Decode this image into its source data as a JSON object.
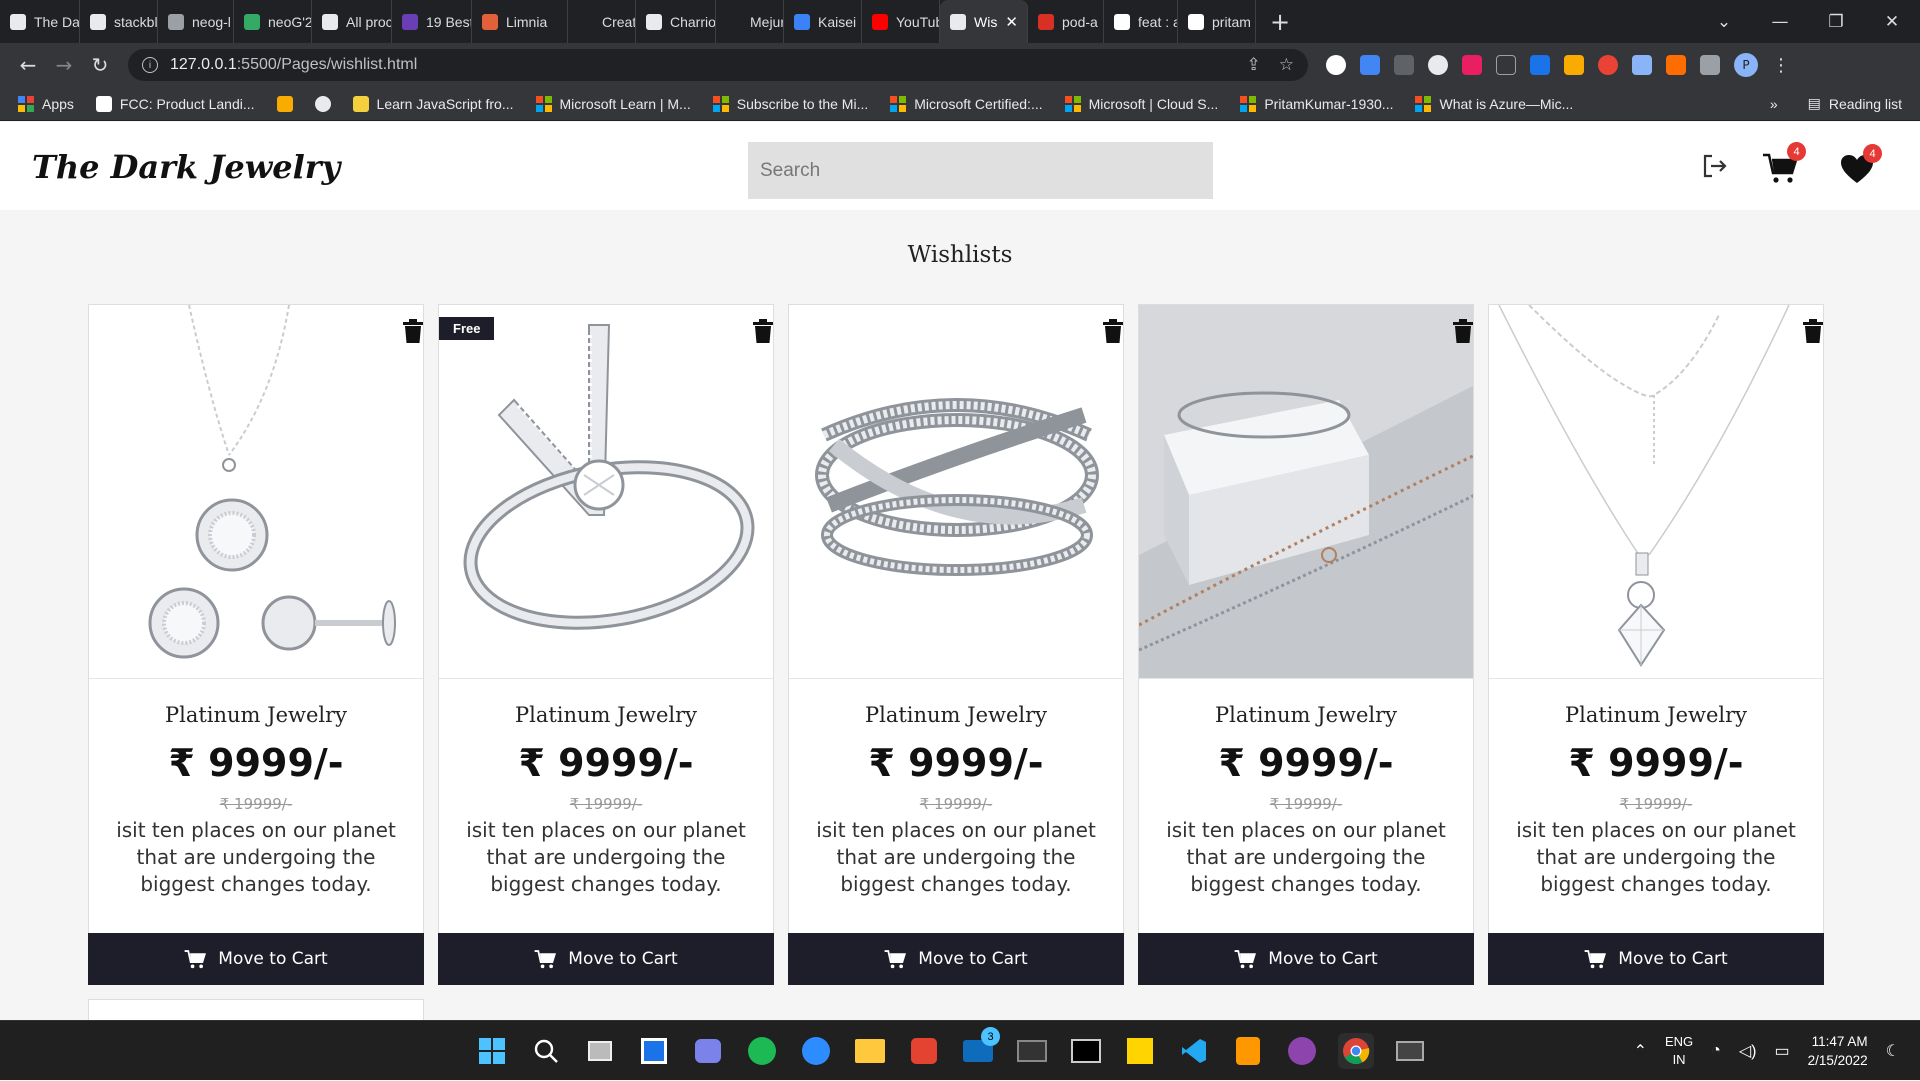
{
  "browser": {
    "tabs": [
      {
        "title": "The Da",
        "color": "#e8eaed"
      },
      {
        "title": "stackbl",
        "color": "#e8eaed"
      },
      {
        "title": "neog-l",
        "color": "#9aa0a6"
      },
      {
        "title": "neoG'2",
        "color": "#33aa66"
      },
      {
        "title": "All proc",
        "color": "#e8eaed"
      },
      {
        "title": "19 Best",
        "color": "#6a3fb5"
      },
      {
        "title": "Limnia",
        "color": "#e2603a"
      },
      {
        "title": "Create",
        "color": "#202124"
      },
      {
        "title": "Charrio",
        "color": "#e8eaed"
      },
      {
        "title": "Mejuri",
        "color": "#202124"
      },
      {
        "title": "Kaisei I",
        "color": "#3b82f6"
      },
      {
        "title": "YouTub",
        "color": "#ff0000"
      },
      {
        "title": "Wis",
        "color": "#e8eaed",
        "active": true
      },
      {
        "title": "pod-a",
        "color": "#d93025"
      },
      {
        "title": "feat : a",
        "color": "#ffffff"
      },
      {
        "title": "pritam",
        "color": "#ffffff"
      }
    ],
    "url_host": "127.0.0.1",
    "url_path": ":5500/Pages/wishlist.html",
    "bookmarks": [
      {
        "label": "Apps",
        "icon": "apps-grid-icon"
      },
      {
        "label": "FCC: Product Landi...",
        "icon": "fcc-icon"
      },
      {
        "label": "",
        "icon": "diamond-icon"
      },
      {
        "label": "",
        "icon": "globe-icon"
      },
      {
        "label": "Learn JavaScript fro...",
        "icon": "scrimba-icon"
      },
      {
        "label": "Microsoft Learn | M...",
        "icon": "microsoft-icon"
      },
      {
        "label": "Subscribe to the Mi...",
        "icon": "microsoft-icon"
      },
      {
        "label": "Microsoft Certified:...",
        "icon": "microsoft-icon"
      },
      {
        "label": "Microsoft | Cloud S...",
        "icon": "microsoft-icon"
      },
      {
        "label": "PritamKumar-1930...",
        "icon": "microsoft-icon"
      },
      {
        "label": "What is Azure—Mic...",
        "icon": "microsoft-icon"
      }
    ],
    "more_bookmarks": "»",
    "reading_list": "Reading list",
    "profile_initial": "P"
  },
  "site": {
    "brand": "The Dark Jewelry",
    "search_placeholder": "Search",
    "cart_count": "4",
    "wishlist_count": "4",
    "page_title": "Wishlists"
  },
  "products": [
    {
      "name": "Platinum Jewelry",
      "price": "₹ 9999/-",
      "old_price": "₹ 19999/-",
      "description": "isit ten places on our planet that are undergoing the biggest changes today.",
      "button": "Move to Cart",
      "badge": "",
      "image": "pendant-and-earrings"
    },
    {
      "name": "Platinum Jewelry",
      "price": "₹ 9999/-",
      "old_price": "₹ 19999/-",
      "description": "isit ten places on our planet that are undergoing the biggest changes today.",
      "button": "Move to Cart",
      "badge": "Free",
      "image": "initial-ring"
    },
    {
      "name": "Platinum Jewelry",
      "price": "₹ 9999/-",
      "old_price": "₹ 19999/-",
      "description": "isit ten places on our planet that are undergoing the biggest changes today.",
      "button": "Move to Cart",
      "badge": "",
      "image": "crossover-ring"
    },
    {
      "name": "Platinum Jewelry",
      "price": "₹ 9999/-",
      "old_price": "₹ 19999/-",
      "description": "isit ten places on our planet that are undergoing the biggest changes today.",
      "button": "Move to Cart",
      "badge": "",
      "image": "bracelets"
    },
    {
      "name": "Platinum Jewelry",
      "price": "₹ 9999/-",
      "old_price": "₹ 19999/-",
      "description": "isit ten places on our planet that are undergoing the biggest changes today.",
      "button": "Move to Cart",
      "badge": "",
      "image": "solitaire-necklace"
    }
  ],
  "taskbar": {
    "language": "ENG",
    "region": "IN",
    "time": "11:47 AM",
    "date": "2/15/2022",
    "mail_badge": "3"
  }
}
